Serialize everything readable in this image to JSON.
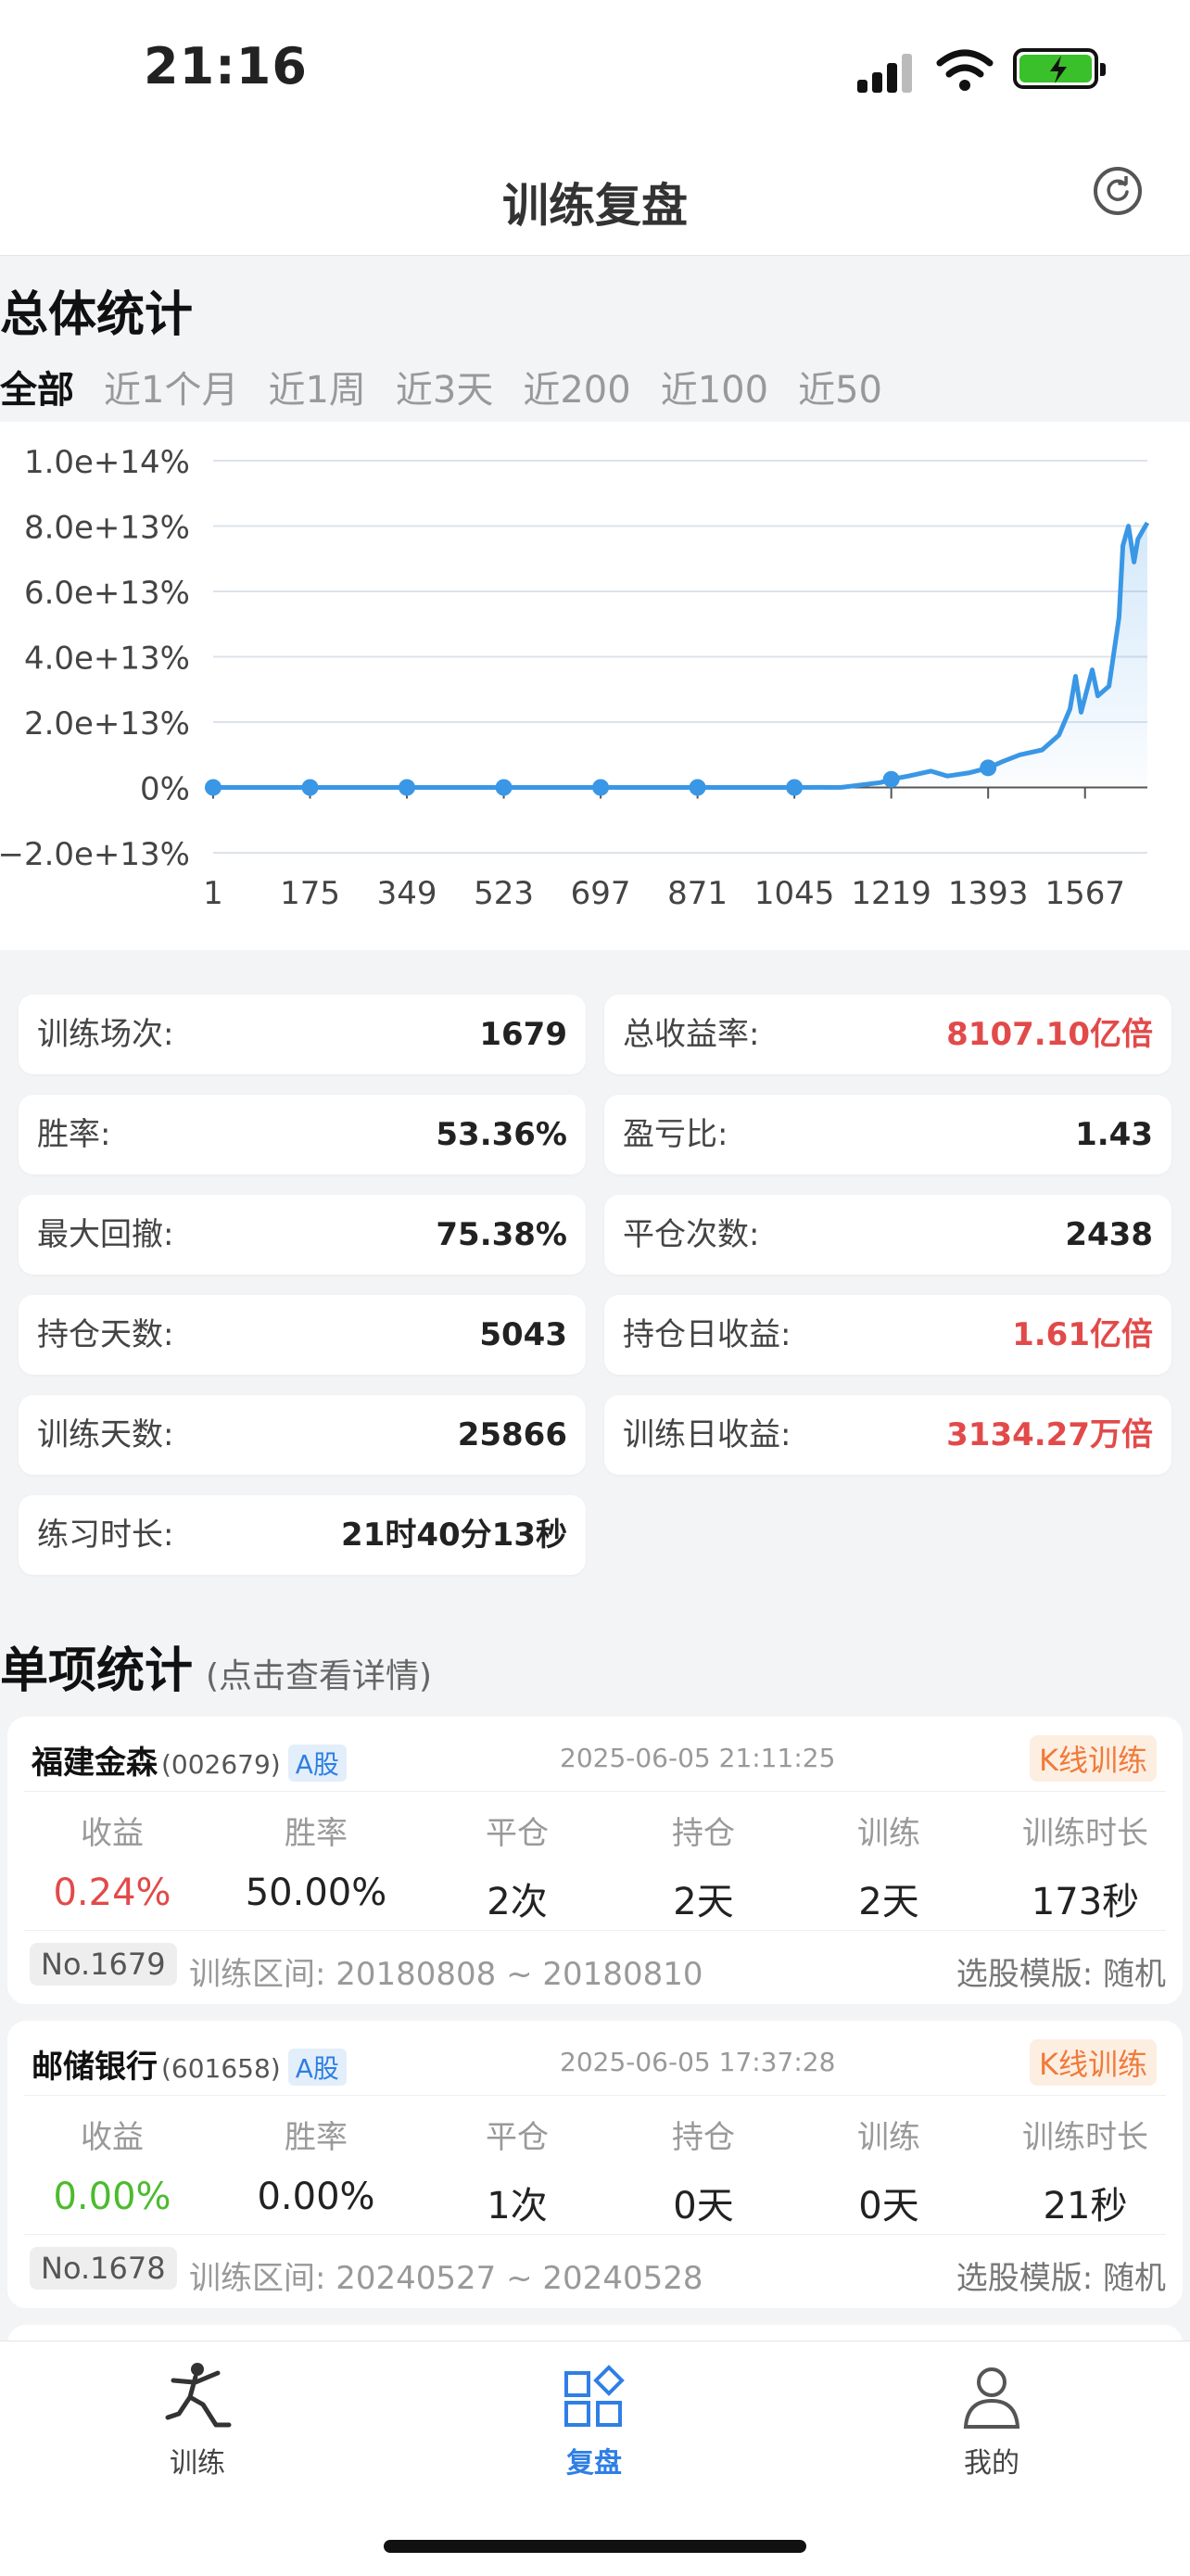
{
  "status": {
    "time": "21:16"
  },
  "nav": {
    "title": "训练复盘"
  },
  "overall": {
    "title": "总体统计",
    "tabs": [
      "全部",
      "近1个月",
      "近1周",
      "近3天",
      "近200",
      "近100",
      "近50"
    ],
    "active_tab": 0
  },
  "chart_data": {
    "type": "area",
    "x_ticks": [
      "1",
      "175",
      "349",
      "523",
      "697",
      "871",
      "1045",
      "1219",
      "1393",
      "1567"
    ],
    "y_ticks": [
      "1.0e+14%",
      "8.0e+13%",
      "6.0e+13%",
      "4.0e+13%",
      "2.0e+13%",
      "0%",
      "−2.0e+13%"
    ],
    "ylim": [
      -20000000000000.0,
      100000000000000.0
    ],
    "xlim": [
      1,
      1679
    ],
    "series": [
      {
        "color": "#3a97e6",
        "points": [
          [
            1,
            0
          ],
          [
            175,
            0
          ],
          [
            349,
            0
          ],
          [
            523,
            0
          ],
          [
            697,
            0
          ],
          [
            871,
            0
          ],
          [
            1045,
            0
          ],
          [
            1130,
            40000000000.0
          ],
          [
            1200,
            1500000000000.0
          ],
          [
            1219,
            2500000000000.0
          ],
          [
            1250,
            3500000000000.0
          ],
          [
            1290,
            5000000000000.0
          ],
          [
            1320,
            3500000000000.0
          ],
          [
            1360,
            4500000000000.0
          ],
          [
            1393,
            6000000000000.0
          ],
          [
            1420,
            8000000000000.0
          ],
          [
            1450,
            10000000000000.0
          ],
          [
            1490,
            11500000000000.0
          ],
          [
            1520,
            16000000000000.0
          ],
          [
            1540,
            24000000000000.0
          ],
          [
            1550,
            34000000000000.0
          ],
          [
            1560,
            23000000000000.0
          ],
          [
            1580,
            36000000000000.0
          ],
          [
            1590,
            28000000000000.0
          ],
          [
            1610,
            31000000000000.0
          ],
          [
            1628,
            52000000000000.0
          ],
          [
            1635,
            74000000000000.0
          ],
          [
            1645,
            80000000000000.0
          ],
          [
            1655,
            69000000000000.0
          ],
          [
            1662,
            76000000000000.0
          ],
          [
            1672,
            79000000000000.0
          ],
          [
            1679,
            81000000000000.0
          ]
        ]
      }
    ],
    "marker_x": [
      1,
      175,
      349,
      523,
      697,
      871,
      1045,
      1219,
      1393
    ],
    "grid": true
  },
  "metrics": [
    {
      "label": "训练场次:",
      "value": "1679",
      "red": false
    },
    {
      "label": "总收益率:",
      "value": "8107.10亿倍",
      "red": true
    },
    {
      "label": "胜率:",
      "value": "53.36%",
      "red": false
    },
    {
      "label": "盈亏比:",
      "value": "1.43",
      "red": false
    },
    {
      "label": "最大回撤:",
      "value": "75.38%",
      "red": false
    },
    {
      "label": "平仓次数:",
      "value": "2438",
      "red": false
    },
    {
      "label": "持仓天数:",
      "value": "5043",
      "red": false
    },
    {
      "label": "持仓日收益:",
      "value": "1.61亿倍",
      "red": true
    },
    {
      "label": "训练天数:",
      "value": "25866",
      "red": false
    },
    {
      "label": "训练日收益:",
      "value": "3134.27万倍",
      "red": true
    },
    {
      "label": "练习时长:",
      "value": "21时40分13秒",
      "red": false
    }
  ],
  "items_section": {
    "title": "单项统计",
    "subtitle": "(点击查看详情)"
  },
  "col_headers": [
    "收益",
    "胜率",
    "平仓",
    "持仓",
    "训练",
    "训练时长"
  ],
  "items": [
    {
      "name": "福建金森",
      "code": "(002679)",
      "market": "A股",
      "datetime": "2025-06-05 21:11:25",
      "tag": "K线训练",
      "values": [
        "0.24%",
        "50.00%",
        "2次",
        "2天",
        "2天",
        "173秒"
      ],
      "profit_color": "red",
      "no": "No.1679",
      "range": "训练区间: 20180808 ~ 20180810",
      "template": "选股模版: 随机"
    },
    {
      "name": "邮储银行",
      "code": "(601658)",
      "market": "A股",
      "datetime": "2025-06-05 17:37:28",
      "tag": "K线训练",
      "values": [
        "0.00%",
        "0.00%",
        "1次",
        "0天",
        "0天",
        "21秒"
      ],
      "profit_color": "green",
      "no": "No.1678",
      "range": "训练区间: 20240527 ~ 20240528",
      "template": "选股模版: 随机"
    }
  ],
  "tabbar": [
    {
      "label": "训练",
      "icon": "kungfu-figure-icon",
      "active": false
    },
    {
      "label": "复盘",
      "icon": "grid-diamond-icon",
      "active": true
    },
    {
      "label": "我的",
      "icon": "person-icon",
      "active": false
    }
  ],
  "colors": {
    "accent": "#2f7fe6",
    "profit_red": "#e24a4a",
    "profit_green": "#4cbb2e",
    "tag_orange": "#f07b3a"
  }
}
